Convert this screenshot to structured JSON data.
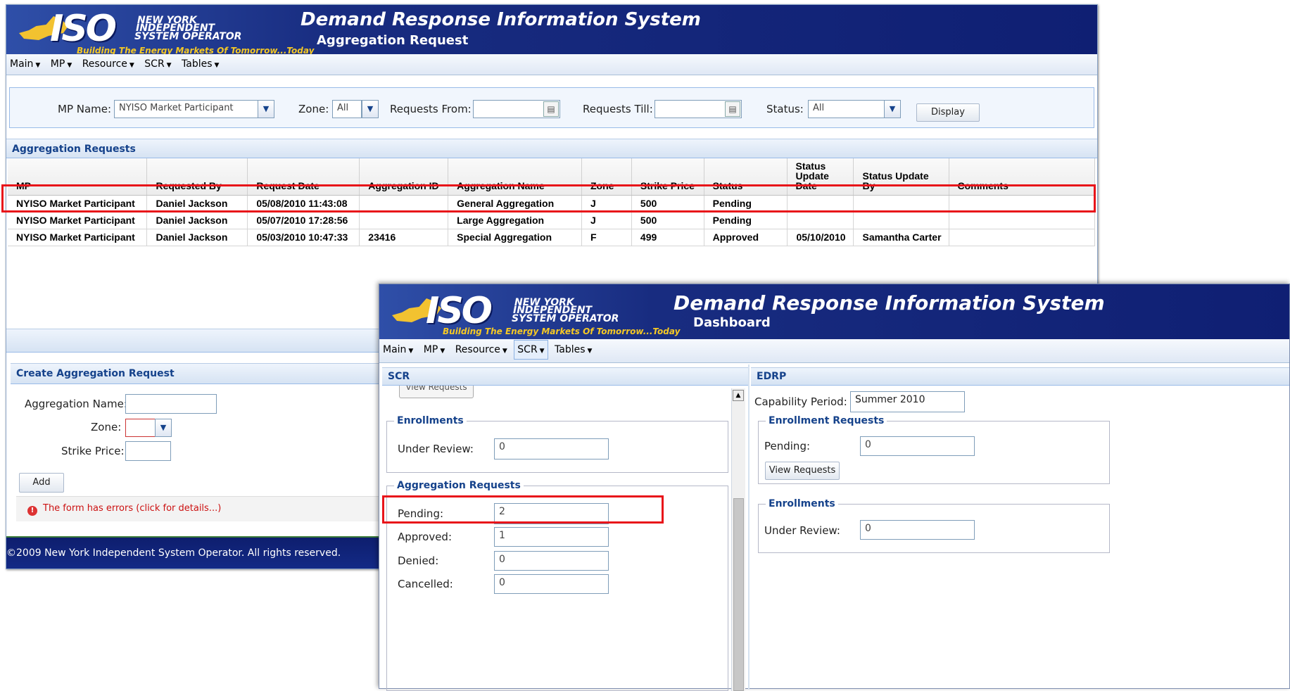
{
  "logo": {
    "line1": "NEW YORK",
    "line2": "INDEPENDENT",
    "line3": "SYSTEM OPERATOR",
    "tagline": "Building The Energy Markets Of Tomorrow...Today"
  },
  "app_title": "Demand Response Information System",
  "menu": [
    "Main",
    "MP",
    "Resource",
    "SCR",
    "Tables"
  ],
  "window1": {
    "subtitle": "Aggregation Request",
    "filters": {
      "mp_name_label": "MP Name:",
      "mp_name_value": "NYISO Market Participant",
      "zone_label": "Zone:",
      "zone_value": "All",
      "requests_from_label": "Requests From:",
      "requests_till_label": "Requests Till:",
      "status_label": "Status:",
      "status_value": "All",
      "display_button": "Display"
    },
    "grid_title": "Aggregation Requests",
    "columns": [
      "MP",
      "Requested By",
      "Request Date",
      "Aggregation ID",
      "Aggregation Name",
      "Zone",
      "Strike Price",
      "Status",
      "Status Update Date",
      "Status Update By",
      "Comments"
    ],
    "rows": [
      [
        "NYISO Market Participant",
        "Daniel Jackson",
        "05/08/2010 11:43:08",
        "",
        "General Aggregation",
        "J",
        "500",
        "Pending",
        "",
        "",
        ""
      ],
      [
        "NYISO Market Participant",
        "Daniel Jackson",
        "05/07/2010 17:28:56",
        "",
        "Large Aggregation",
        "J",
        "500",
        "Pending",
        "",
        "",
        ""
      ],
      [
        "NYISO Market Participant",
        "Daniel Jackson",
        "05/03/2010 10:47:33",
        "23416",
        "Special Aggregation",
        "F",
        "499",
        "Approved",
        "05/10/2010",
        "Samantha Carter",
        ""
      ]
    ],
    "create": {
      "title": "Create Aggregation Request",
      "name_label": "Aggregation Name:",
      "zone_label": "Zone:",
      "strike_label": "Strike Price:",
      "add_button": "Add",
      "error": "The form has errors (click for details...)"
    },
    "footer": "©2009   New York Independent System Operator. All rights reserved."
  },
  "window2": {
    "subtitle": "Dashboard",
    "scr": {
      "title": "SCR",
      "partial_button": "View Requests",
      "enrollments_legend": "Enrollments",
      "under_review_label": "Under Review:",
      "under_review_value": "0",
      "agg_legend": "Aggregation Requests",
      "pending_label": "Pending:",
      "pending_value": "2",
      "approved_label": "Approved:",
      "approved_value": "1",
      "denied_label": "Denied:",
      "denied_value": "0",
      "cancelled_label": "Cancelled:",
      "cancelled_value": "0"
    },
    "edrp": {
      "title": "EDRP",
      "cap_label": "Capability Period:",
      "cap_value": "Summer 2010",
      "enroll_req_legend": "Enrollment Requests",
      "pending_label": "Pending:",
      "pending_value": "0",
      "view_button": "View Requests",
      "enroll_legend": "Enrollments",
      "under_review_label": "Under Review:",
      "under_review_value": "0"
    }
  },
  "colors": {
    "highlight": "#e8141a",
    "banner": "#182c80",
    "header_text": "#15428b"
  }
}
